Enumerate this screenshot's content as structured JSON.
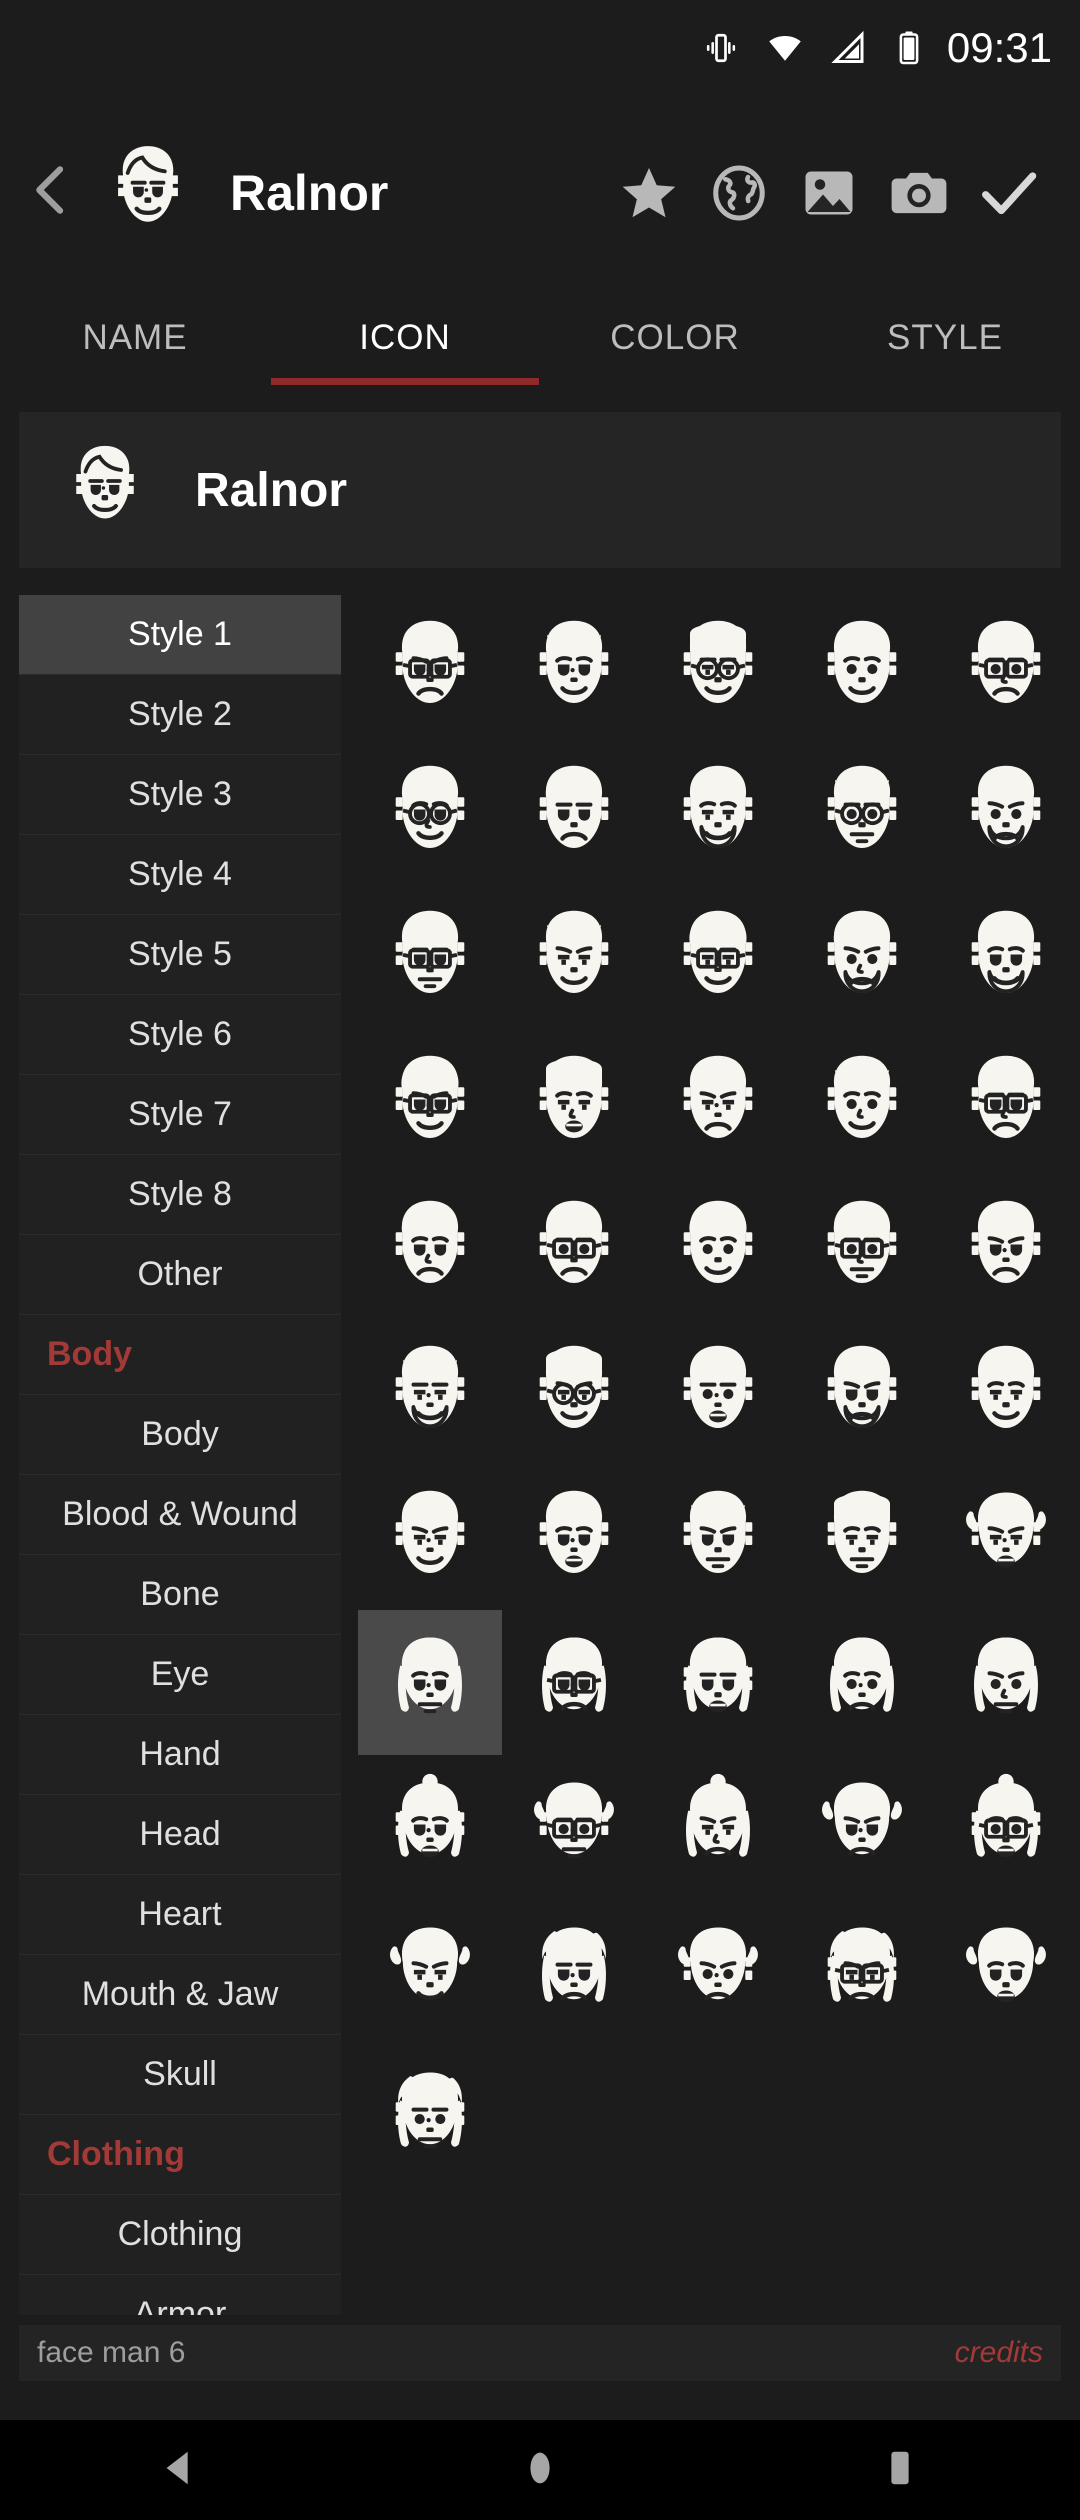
{
  "statusbar": {
    "time": "09:31",
    "icons": [
      "vibrate-icon",
      "wifi-icon",
      "signal-icon",
      "battery-icon"
    ]
  },
  "appbar": {
    "back_icon": "back-chevron-icon",
    "avatar_icon": "face-man-6-icon",
    "title": "Ralnor",
    "actions": [
      {
        "name": "favorite-star-icon",
        "label": "star"
      },
      {
        "name": "globe-icon",
        "label": "globe"
      },
      {
        "name": "image-icon",
        "label": "image"
      },
      {
        "name": "camera-icon",
        "label": "camera"
      },
      {
        "name": "confirm-check-icon",
        "label": "check"
      }
    ]
  },
  "tabs": [
    {
      "label": "NAME",
      "active": false
    },
    {
      "label": "ICON",
      "active": true
    },
    {
      "label": "COLOR",
      "active": false
    },
    {
      "label": "STYLE",
      "active": false
    }
  ],
  "character_card": {
    "avatar_icon": "face-man-6-icon",
    "name": "Ralnor"
  },
  "sidebar": {
    "items": [
      {
        "label": "Style 1",
        "type": "item",
        "selected": true
      },
      {
        "label": "Style 2",
        "type": "item",
        "selected": false
      },
      {
        "label": "Style 3",
        "type": "item",
        "selected": false
      },
      {
        "label": "Style 4",
        "type": "item",
        "selected": false
      },
      {
        "label": "Style 5",
        "type": "item",
        "selected": false
      },
      {
        "label": "Style 6",
        "type": "item",
        "selected": false
      },
      {
        "label": "Style 7",
        "type": "item",
        "selected": false
      },
      {
        "label": "Style 8",
        "type": "item",
        "selected": false
      },
      {
        "label": "Other",
        "type": "item",
        "selected": false
      },
      {
        "label": "Body",
        "type": "section",
        "selected": false
      },
      {
        "label": "Body",
        "type": "item",
        "selected": false
      },
      {
        "label": "Blood & Wound",
        "type": "item",
        "selected": false
      },
      {
        "label": "Bone",
        "type": "item",
        "selected": false
      },
      {
        "label": "Eye",
        "type": "item",
        "selected": false
      },
      {
        "label": "Hand",
        "type": "item",
        "selected": false
      },
      {
        "label": "Head",
        "type": "item",
        "selected": false
      },
      {
        "label": "Heart",
        "type": "item",
        "selected": false
      },
      {
        "label": "Mouth & Jaw",
        "type": "item",
        "selected": false
      },
      {
        "label": "Skull",
        "type": "item",
        "selected": false
      },
      {
        "label": "Clothing",
        "type": "section",
        "selected": false
      },
      {
        "label": "Clothing",
        "type": "item",
        "selected": false
      },
      {
        "label": "Armor",
        "type": "item",
        "selected": false
      }
    ]
  },
  "icon_grid": {
    "columns": 5,
    "selected_index": 35,
    "icons": [
      {
        "name": "face-man-1-icon",
        "variant": "m-wavy-glasses"
      },
      {
        "name": "face-man-2-icon",
        "variant": "m-spiky-square"
      },
      {
        "name": "face-man-3-icon",
        "variant": "m-side-glasses"
      },
      {
        "name": "face-man-4-icon",
        "variant": "m-curly-smile"
      },
      {
        "name": "face-man-5-icon",
        "variant": "m-brow-glasses"
      },
      {
        "name": "face-man-6b-icon",
        "variant": "m-bald-glasses"
      },
      {
        "name": "face-man-7-icon",
        "variant": "m-grimace"
      },
      {
        "name": "face-man-8-icon",
        "variant": "m-stubble"
      },
      {
        "name": "face-man-9-icon",
        "variant": "m-round-glasses"
      },
      {
        "name": "face-man-10-icon",
        "variant": "m-beard-bald"
      },
      {
        "name": "face-man-11-icon",
        "variant": "m-glasses-flat"
      },
      {
        "name": "face-man-12-icon",
        "variant": "m-short-hair"
      },
      {
        "name": "face-man-13-icon",
        "variant": "m-afro-glasses"
      },
      {
        "name": "face-man-14-icon",
        "variant": "m-curly-mustache"
      },
      {
        "name": "face-man-15-icon",
        "variant": "m-frown-beard"
      },
      {
        "name": "face-man-16-icon",
        "variant": "m-elder-glasses"
      },
      {
        "name": "face-man-17-icon",
        "variant": "m-flat-top"
      },
      {
        "name": "face-man-18-icon",
        "variant": "m-mohawk-earring"
      },
      {
        "name": "face-man-19-icon",
        "variant": "m-swept-hair"
      },
      {
        "name": "face-man-20-icon",
        "variant": "m-bald-glasses2"
      },
      {
        "name": "face-man-21-icon",
        "variant": "m-long-bangs"
      },
      {
        "name": "face-man-22-icon",
        "variant": "m-side-part-glasses"
      },
      {
        "name": "face-man-23-icon",
        "variant": "m-freckles"
      },
      {
        "name": "face-man-24-icon",
        "variant": "m-square-glasses"
      },
      {
        "name": "face-man-25-icon",
        "variant": "m-spiked-hair"
      },
      {
        "name": "face-man-26-icon",
        "variant": "m-old-beard"
      },
      {
        "name": "face-man-27-icon",
        "variant": "m-grandpa-glasses"
      },
      {
        "name": "face-man-28-icon",
        "variant": "m-bald-wrinkle"
      },
      {
        "name": "face-man-29-icon",
        "variant": "m-boxy-beard"
      },
      {
        "name": "face-man-30-icon",
        "variant": "m-sad-bald"
      },
      {
        "name": "face-man-6-icon",
        "variant": "m-swept-young"
      },
      {
        "name": "face-man-31-icon",
        "variant": "m-crimped-hair"
      },
      {
        "name": "face-man-32-icon",
        "variant": "m-bob-hair"
      },
      {
        "name": "face-man-33-icon",
        "variant": "m-wavy-short"
      },
      {
        "name": "face-woman-1-icon",
        "variant": "w-wavy-long"
      },
      {
        "name": "face-woman-2-icon",
        "variant": "w-straight-long"
      },
      {
        "name": "face-woman-3-icon",
        "variant": "w-round-glasses"
      },
      {
        "name": "face-woman-4-icon",
        "variant": "w-bob-shock"
      },
      {
        "name": "face-woman-5-icon",
        "variant": "w-top-bun"
      },
      {
        "name": "face-woman-6-icon",
        "variant": "w-braids"
      },
      {
        "name": "face-woman-7-icon",
        "variant": "w-bun-neat"
      },
      {
        "name": "face-woman-8-icon",
        "variant": "w-glasses-curls"
      },
      {
        "name": "face-woman-9-icon",
        "variant": "w-long-straight"
      },
      {
        "name": "face-woman-10-icon",
        "variant": "w-headband"
      },
      {
        "name": "face-woman-11-icon",
        "variant": "w-glasses-band"
      },
      {
        "name": "face-woman-12-icon",
        "variant": "w-freckle-short"
      },
      {
        "name": "face-woman-13-icon",
        "variant": "w-wild-hair"
      },
      {
        "name": "face-woman-14-icon",
        "variant": "w-updo"
      },
      {
        "name": "face-woman-15-icon",
        "variant": "w-glasses-updo"
      },
      {
        "name": "face-woman-16-icon",
        "variant": "w-pigtails"
      },
      {
        "name": "face-woman-17-icon",
        "variant": "w-bunny-ears"
      }
    ]
  },
  "footer": {
    "label": "face man 6",
    "credits": "credits"
  },
  "navbar": {
    "back": "nav-back-icon",
    "home": "nav-home-icon",
    "recents": "nav-recents-icon"
  },
  "colors": {
    "background": "#1c1c1c",
    "card": "#252525",
    "sidebar_item": "#212121",
    "sidebar_selected": "#424242",
    "accent_red": "#a33a37",
    "tab_indicator": "#8e2a2a",
    "icon_white": "#f7f5f0",
    "text_primary": "#ffffff",
    "text_secondary": "#bdbdbd"
  }
}
